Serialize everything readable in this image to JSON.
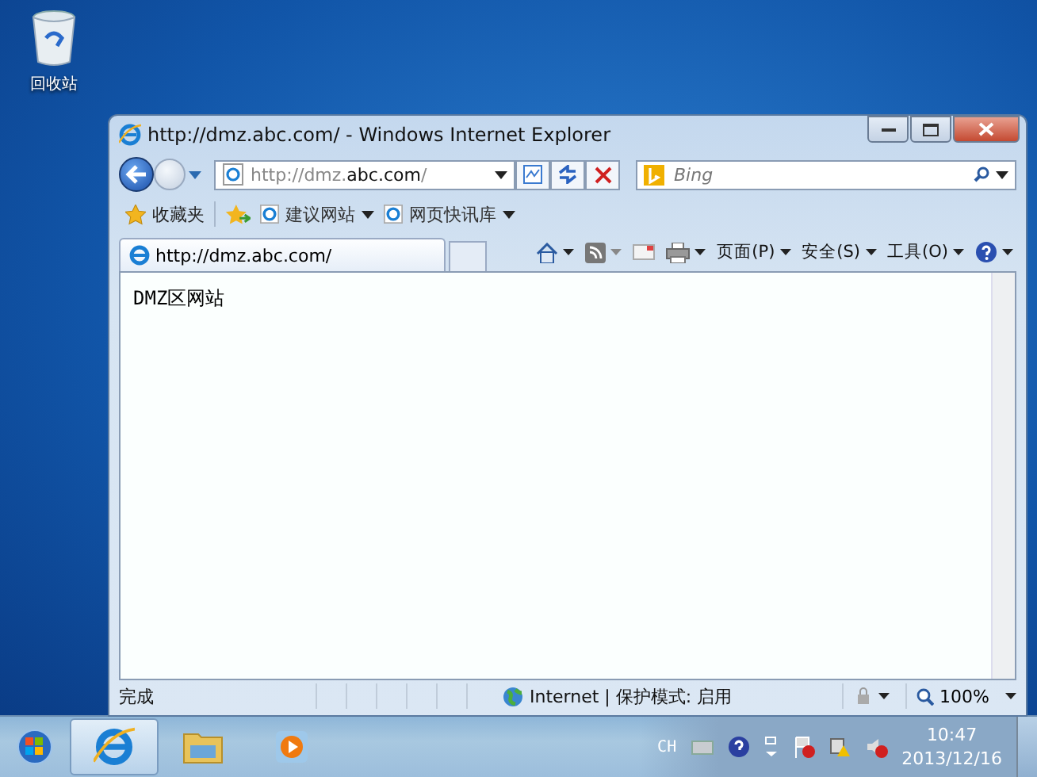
{
  "desktop_icons": [
    {
      "label": "回收站"
    }
  ],
  "window": {
    "title": "http://dmz.abc.com/ - Windows Internet Explorer"
  },
  "navigation": {
    "address": "http://dmz.**abc.com**/",
    "search": {
      "placeholder": "Bing"
    }
  },
  "favorites_bar": {
    "label": "收藏夹",
    "links": [
      {
        "label": "建议网站"
      },
      {
        "label": "网页快讯库"
      }
    ]
  },
  "tabs": [
    {
      "label": "http://dmz.abc.com/",
      "selected": true
    }
  ],
  "command_bar": {
    "menus": [
      {
        "label": "页面(P)"
      },
      {
        "label": "安全(S)"
      },
      {
        "label": "工具(O)"
      }
    ]
  },
  "page": {
    "text": "DMZ区网站"
  },
  "status_bar": {
    "status": "完成",
    "zone": "Internet | 保护模式: 启用",
    "zoom": "100%"
  },
  "taskbar": {
    "apps": [
      {
        "kind": "ie",
        "selected": true
      },
      {
        "kind": "folder",
        "selected": false
      },
      {
        "kind": "media",
        "selected": false
      }
    ],
    "language": "CH",
    "time": "10:47",
    "date": "2013/12/16"
  }
}
